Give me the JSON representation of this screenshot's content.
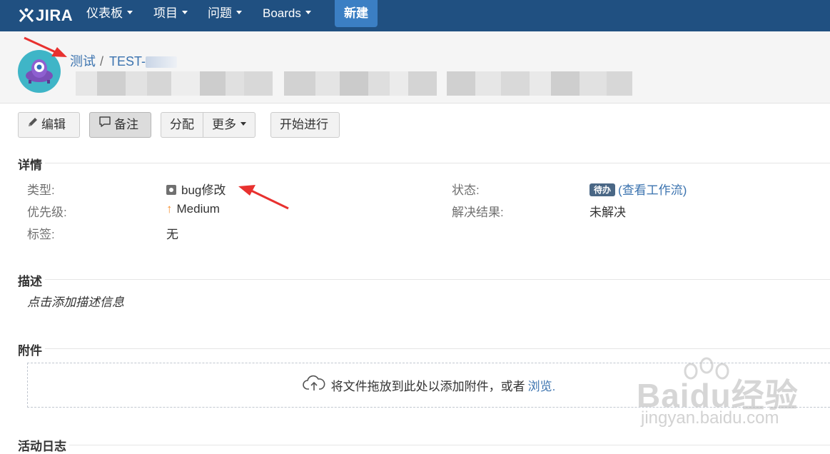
{
  "nav": {
    "logo_text": "JIRA",
    "items": [
      {
        "label": "仪表板"
      },
      {
        "label": "项目"
      },
      {
        "label": "问题"
      },
      {
        "label": "Boards"
      }
    ],
    "create_label": "新建"
  },
  "issue": {
    "project_name": "测试",
    "key_prefix": "TEST-"
  },
  "toolbar": {
    "edit_label": "编辑",
    "comment_label": "备注",
    "assign_label": "分配",
    "more_label": "更多",
    "start_label": "开始进行"
  },
  "details": {
    "heading": "详情",
    "type_label": "类型:",
    "type_value": "bug修改",
    "priority_label": "优先级:",
    "priority_value": "Medium",
    "labels_label": "标签:",
    "labels_value": "无",
    "status_label": "状态:",
    "status_value": "待办",
    "workflow_open": "(",
    "workflow_link": "查看工作流",
    "workflow_close": ")",
    "resolution_label": "解决结果:",
    "resolution_value": "未解决"
  },
  "description": {
    "heading": "描述",
    "placeholder": "点击添加描述信息"
  },
  "attachments": {
    "heading": "附件",
    "drop_text": "将文件拖放到此处以添加附件，或者",
    "browse_link": "浏览."
  },
  "activity": {
    "heading": "活动日志"
  },
  "watermark": {
    "brand": "Baidu经验",
    "url": "jingyan.baidu.com"
  },
  "colors": {
    "nav_bg": "#205081",
    "create_button": "#3b7fc4",
    "link": "#3b73af",
    "status_lozenge": "#4a6785",
    "priority_arrow": "#f79232",
    "annotation_arrow": "#e8312f"
  },
  "icons": [
    "jira-logo-icon",
    "caret-down-icon",
    "pencil-icon",
    "comment-icon",
    "bug-type-icon",
    "priority-up-arrow-icon",
    "cloud-upload-icon"
  ]
}
